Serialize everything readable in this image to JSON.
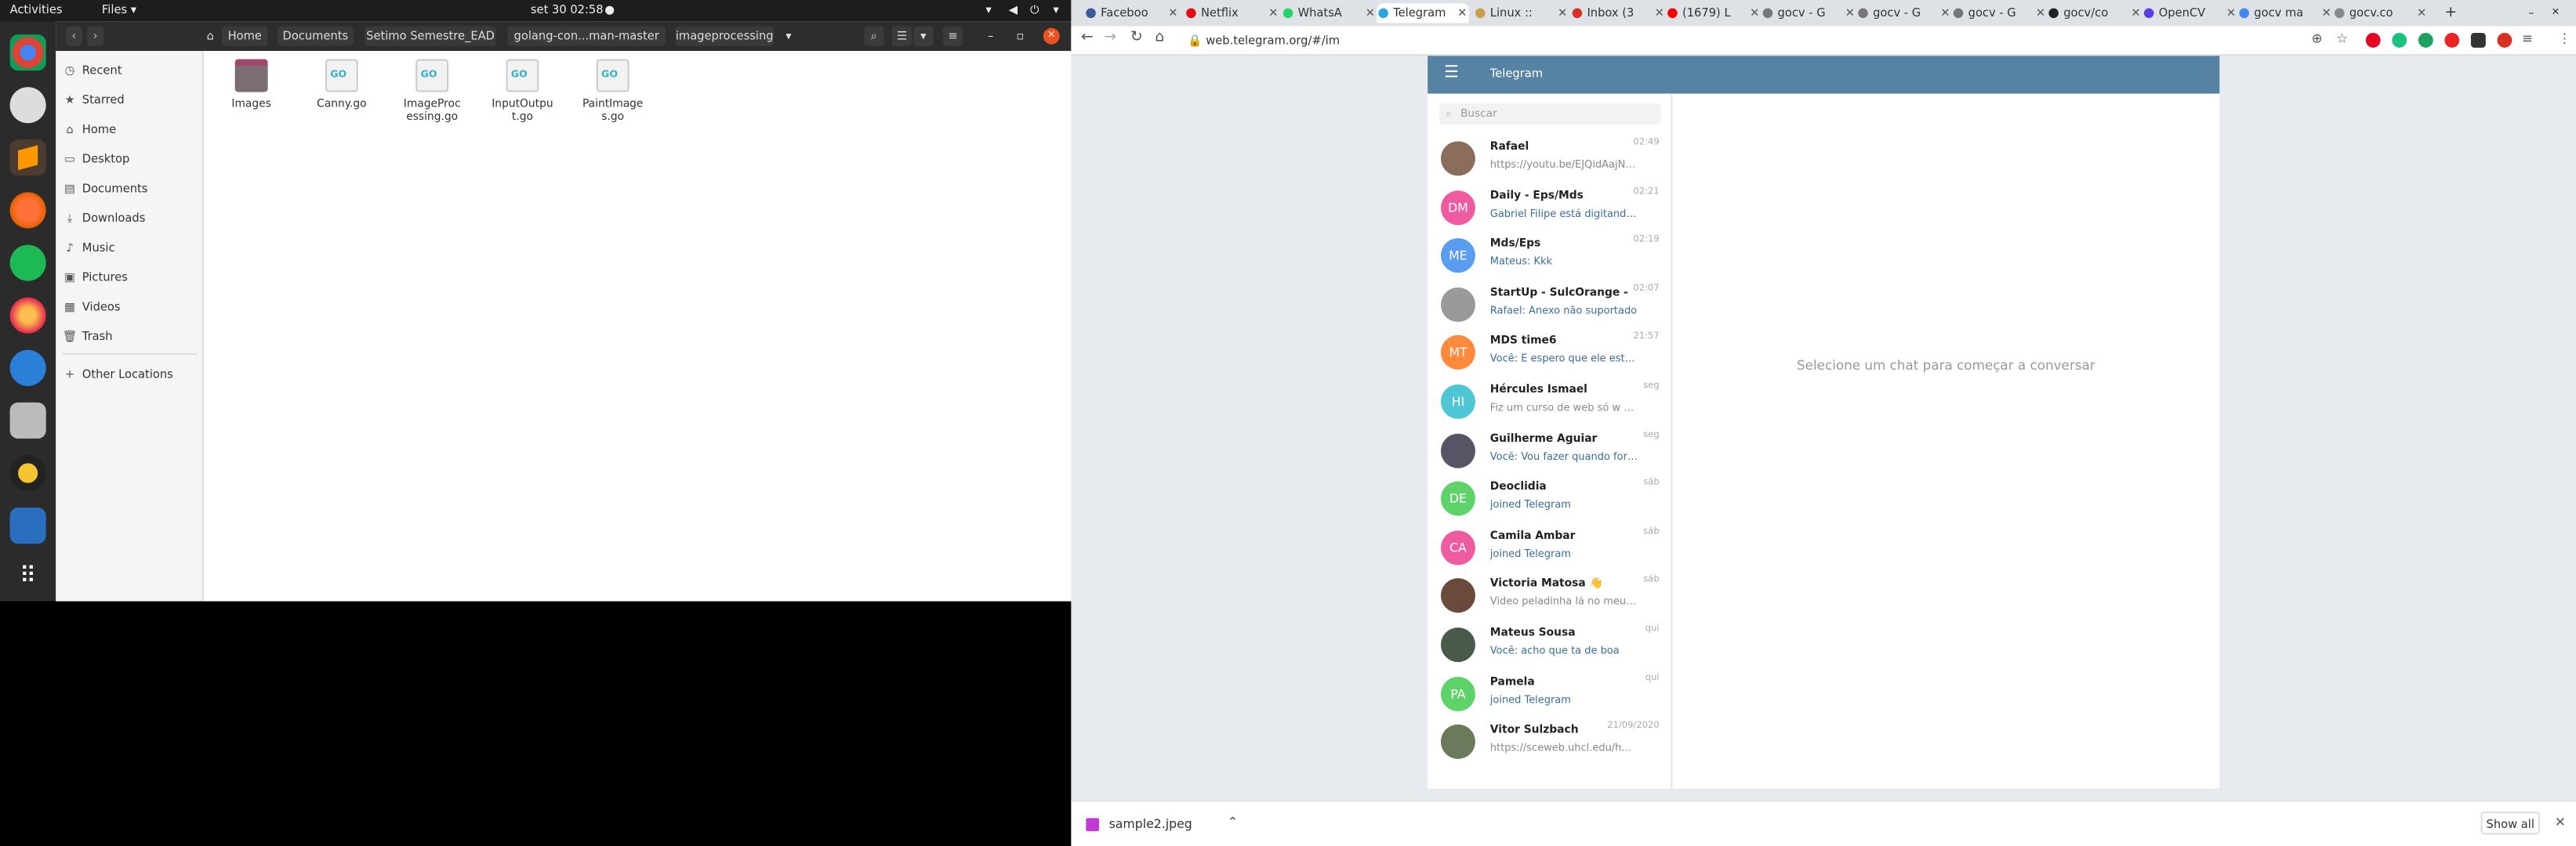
{
  "system": {
    "activities": "Activities",
    "app_menu": "Files ▾",
    "clock": "set 30  02:58"
  },
  "dock": {
    "apps": [
      "chrome-icon",
      "settings-icon",
      "sublime-icon",
      "firefox-icon",
      "spotify-icon",
      "firefox-dev-icon",
      "thunderbird-icon",
      "files-icon",
      "rhythmbox-icon",
      "writer-icon",
      "app-grid-icon"
    ]
  },
  "files": {
    "breadcrumbs": [
      "Home",
      "Documents",
      "Setimo Semestre_EAD",
      "golang-con...man-master",
      "imageprocessing"
    ],
    "sidebar": [
      "Recent",
      "Starred",
      "Home",
      "Desktop",
      "Documents",
      "Downloads",
      "Music",
      "Pictures",
      "Videos",
      "Trash",
      "Other Locations"
    ],
    "items": [
      {
        "name": "Images",
        "kind": "folder"
      },
      {
        "name": "Canny.go",
        "kind": "go"
      },
      {
        "name": "ImageProc essing.go",
        "kind": "go"
      },
      {
        "name": "InputOutpu t.go",
        "kind": "go"
      },
      {
        "name": "PaintImage s.go",
        "kind": "go"
      }
    ]
  },
  "browser": {
    "tabs": [
      "Faceboo",
      "Netflix",
      "WhatsA",
      "Telegram",
      "Linux ::",
      "Inbox (3",
      "(1679) L",
      "gocv - G",
      "gocv - G",
      "gocv - G",
      "gocv/co",
      "OpenCV",
      "gocv ma",
      "gocv.co"
    ],
    "url": "web.telegram.org/#/im",
    "download": "sample2.jpeg",
    "show_all": "Show all"
  },
  "telegram": {
    "title": "Telegram",
    "search_placeholder": "Buscar",
    "empty_text": "Selecione um chat para começar a conversar",
    "chats": [
      {
        "name": "Rafael",
        "time": "02:49",
        "preview": "https://youtu.be/EJQidAajNgVA",
        "initials": "",
        "color": "#8a6d5a",
        "blue": false
      },
      {
        "name": "Daily - Eps/Mds",
        "time": "02:21",
        "preview": "Gabriel Filipe está digitando ...",
        "initials": "DM",
        "color": "#ee5ba0",
        "blue": true
      },
      {
        "name": "Mds/Eps",
        "time": "02:19",
        "preview": "Mateus: Kkk",
        "initials": "ME",
        "color": "#5a9cf0",
        "blue": true
      },
      {
        "name": "StartUp - SulcOrange - AI ap...",
        "time": "02:07",
        "preview": "Rafael: Anexo não suportado",
        "initials": "",
        "color": "#999",
        "blue": true
      },
      {
        "name": "MDS time6",
        "time": "21:57",
        "preview": "Você: E espero que ele esteja...",
        "initials": "MT",
        "color": "#ff8a3d",
        "blue": true
      },
      {
        "name": "Hércules Ismael",
        "time": "seg",
        "preview": "Fiz um curso de web só w usav...",
        "initials": "HI",
        "color": "#4fc6d4",
        "blue": false
      },
      {
        "name": "Guilherme Aguiar",
        "time": "seg",
        "preview": "Você: Vou fazer quando for nec...",
        "initials": "",
        "color": "#556",
        "blue": true
      },
      {
        "name": "Deoclidia",
        "time": "sáb",
        "preview": "joined Telegram",
        "initials": "DE",
        "color": "#5fd36a",
        "blue": true
      },
      {
        "name": "Camila Ambar",
        "time": "sáb",
        "preview": "joined Telegram",
        "initials": "CA",
        "color": "#ee5ba0",
        "blue": true
      },
      {
        "name": "Victoria Matosa 👋",
        "time": "sáb",
        "preview": "Video peladinha lá no meu site ...",
        "initials": "",
        "color": "#6a4a3a",
        "blue": false
      },
      {
        "name": "Mateus Sousa",
        "time": "qui",
        "preview": "Você: acho que ta de boa",
        "initials": "",
        "color": "#4a5a4a",
        "blue": true
      },
      {
        "name": "Pamela",
        "time": "qui",
        "preview": "joined Telegram",
        "initials": "PA",
        "color": "#5fd36a",
        "blue": true
      },
      {
        "name": "Vitor Sulzbach",
        "time": "21/09/2020",
        "preview": "https://sceweb.uhcl.edu/h...",
        "initials": "",
        "color": "#6a7a5a",
        "blue": false
      }
    ]
  }
}
